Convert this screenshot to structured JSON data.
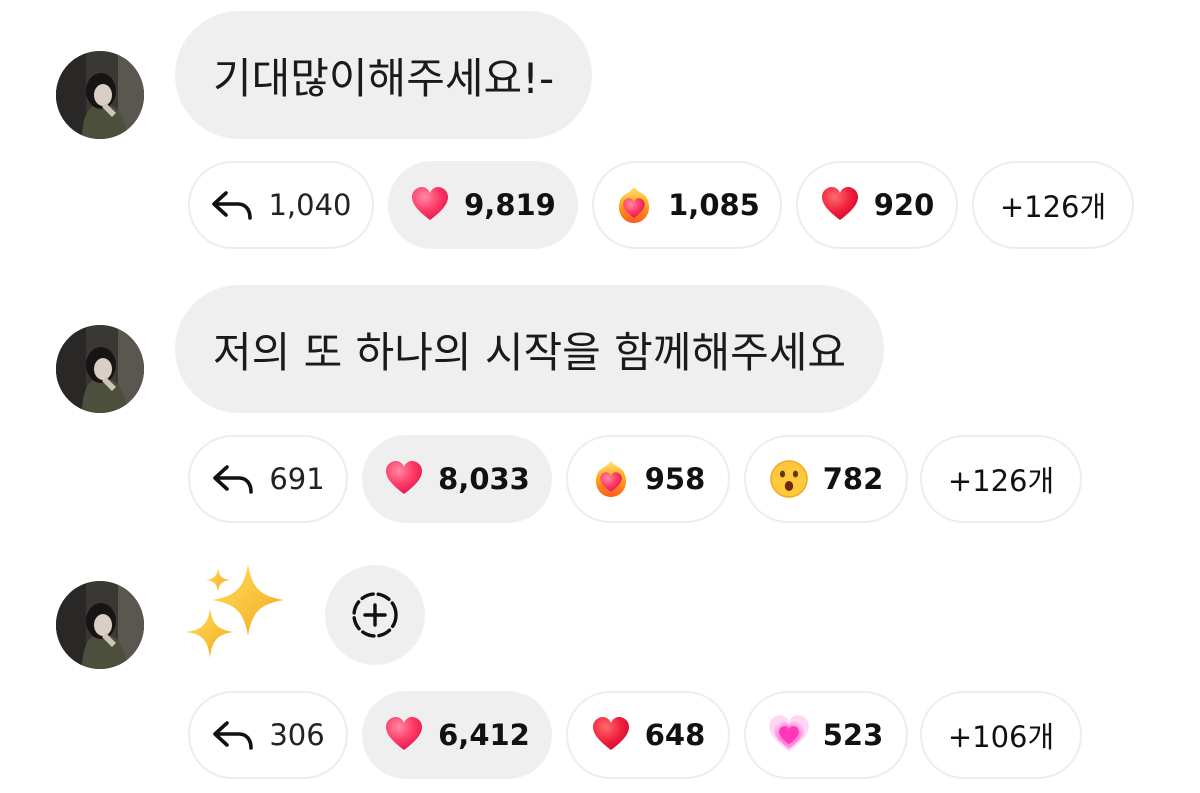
{
  "messages": [
    {
      "text": "기대많이해주세요!-",
      "reactions": {
        "replies": "1,040",
        "heart": "9,819",
        "heart_fire": "1,085",
        "red_heart": "920",
        "more": "+126개"
      },
      "reaction_icons": [
        "reply-arrow-icon",
        "pink-heart-icon",
        "heart-on-fire-icon",
        "red-heart-icon"
      ]
    },
    {
      "text": "저의 또 하나의 시작을 함께해주세요",
      "reactions": {
        "replies": "691",
        "heart": "8,033",
        "heart_fire": "958",
        "surprised": "782",
        "more": "+126개"
      },
      "reaction_icons": [
        "reply-arrow-icon",
        "pink-heart-icon",
        "heart-on-fire-icon",
        "surprised-face-icon"
      ]
    },
    {
      "text": "",
      "emoji": "sparkles-emoji",
      "reactions": {
        "replies": "306",
        "heart": "6,412",
        "red_heart": "648",
        "growing_heart": "523",
        "more": "+106개"
      },
      "reaction_icons": [
        "reply-arrow-icon",
        "pink-heart-icon",
        "red-heart-icon",
        "growing-heart-icon"
      ]
    }
  ],
  "colors": {
    "bubble_bg": "#efefef",
    "pill_border": "#ededed",
    "heart_pink": "#ff3e6c",
    "heart_red": "#f0203e",
    "sparkle": "#ffc72c"
  }
}
